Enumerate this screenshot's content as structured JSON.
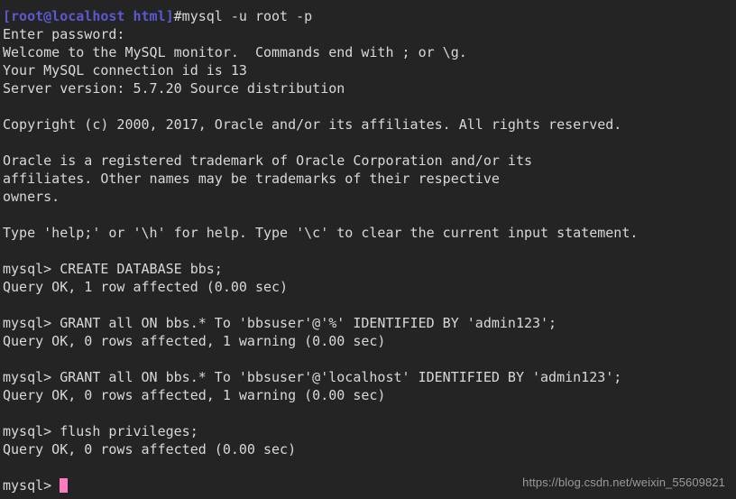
{
  "terminal": {
    "background_color": "#242424",
    "foreground_color": "#d8d8d8",
    "prompt_color": "#5b59cf",
    "cursor_color": "#ff7bbf",
    "lines": [
      {
        "id": "line-0-partial",
        "type": "partial",
        "text": ""
      },
      {
        "id": "line-1-prompt-command",
        "type": "prompt",
        "prompt": "[root@localhost html]",
        "text": "#mysql -u root -p"
      },
      {
        "id": "line-2",
        "type": "output",
        "text": "Enter password:"
      },
      {
        "id": "line-3",
        "type": "output",
        "text": "Welcome to the MySQL monitor.  Commands end with ; or \\g."
      },
      {
        "id": "line-4",
        "type": "output",
        "text": "Your MySQL connection id is 13"
      },
      {
        "id": "line-5",
        "type": "output",
        "text": "Server version: 5.7.20 Source distribution"
      },
      {
        "id": "line-6",
        "type": "blank",
        "text": ""
      },
      {
        "id": "line-7",
        "type": "output",
        "text": "Copyright (c) 2000, 2017, Oracle and/or its affiliates. All rights reserved."
      },
      {
        "id": "line-8",
        "type": "blank",
        "text": ""
      },
      {
        "id": "line-9",
        "type": "output",
        "text": "Oracle is a registered trademark of Oracle Corporation and/or its"
      },
      {
        "id": "line-10",
        "type": "output",
        "text": "affiliates. Other names may be trademarks of their respective"
      },
      {
        "id": "line-11",
        "type": "output",
        "text": "owners."
      },
      {
        "id": "line-12",
        "type": "blank",
        "text": ""
      },
      {
        "id": "line-13",
        "type": "output",
        "text": "Type 'help;' or '\\h' for help. Type '\\c' to clear the current input statement."
      },
      {
        "id": "line-14",
        "type": "blank",
        "text": ""
      },
      {
        "id": "line-15",
        "type": "output",
        "text": "mysql> CREATE DATABASE bbs;"
      },
      {
        "id": "line-16",
        "type": "output",
        "text": "Query OK, 1 row affected (0.00 sec)"
      },
      {
        "id": "line-17",
        "type": "blank",
        "text": ""
      },
      {
        "id": "line-18",
        "type": "output",
        "text": "mysql> GRANT all ON bbs.* To 'bbsuser'@'%' IDENTIFIED BY 'admin123';"
      },
      {
        "id": "line-19",
        "type": "output",
        "text": "Query OK, 0 rows affected, 1 warning (0.00 sec)"
      },
      {
        "id": "line-20",
        "type": "blank",
        "text": ""
      },
      {
        "id": "line-21",
        "type": "output",
        "text": "mysql> GRANT all ON bbs.* To 'bbsuser'@'localhost' IDENTIFIED BY 'admin123';"
      },
      {
        "id": "line-22",
        "type": "output",
        "text": "Query OK, 0 rows affected, 1 warning (0.00 sec)"
      },
      {
        "id": "line-23",
        "type": "blank",
        "text": ""
      },
      {
        "id": "line-24",
        "type": "output",
        "text": "mysql> flush privileges;"
      },
      {
        "id": "line-25",
        "type": "output",
        "text": "Query OK, 0 rows affected (0.00 sec)"
      },
      {
        "id": "line-26",
        "type": "blank",
        "text": ""
      },
      {
        "id": "line-27-cursor",
        "type": "prompt-cursor",
        "text": "mysql> "
      }
    ]
  },
  "watermark": {
    "text": "https://blog.csdn.net/weixin_55609821"
  }
}
